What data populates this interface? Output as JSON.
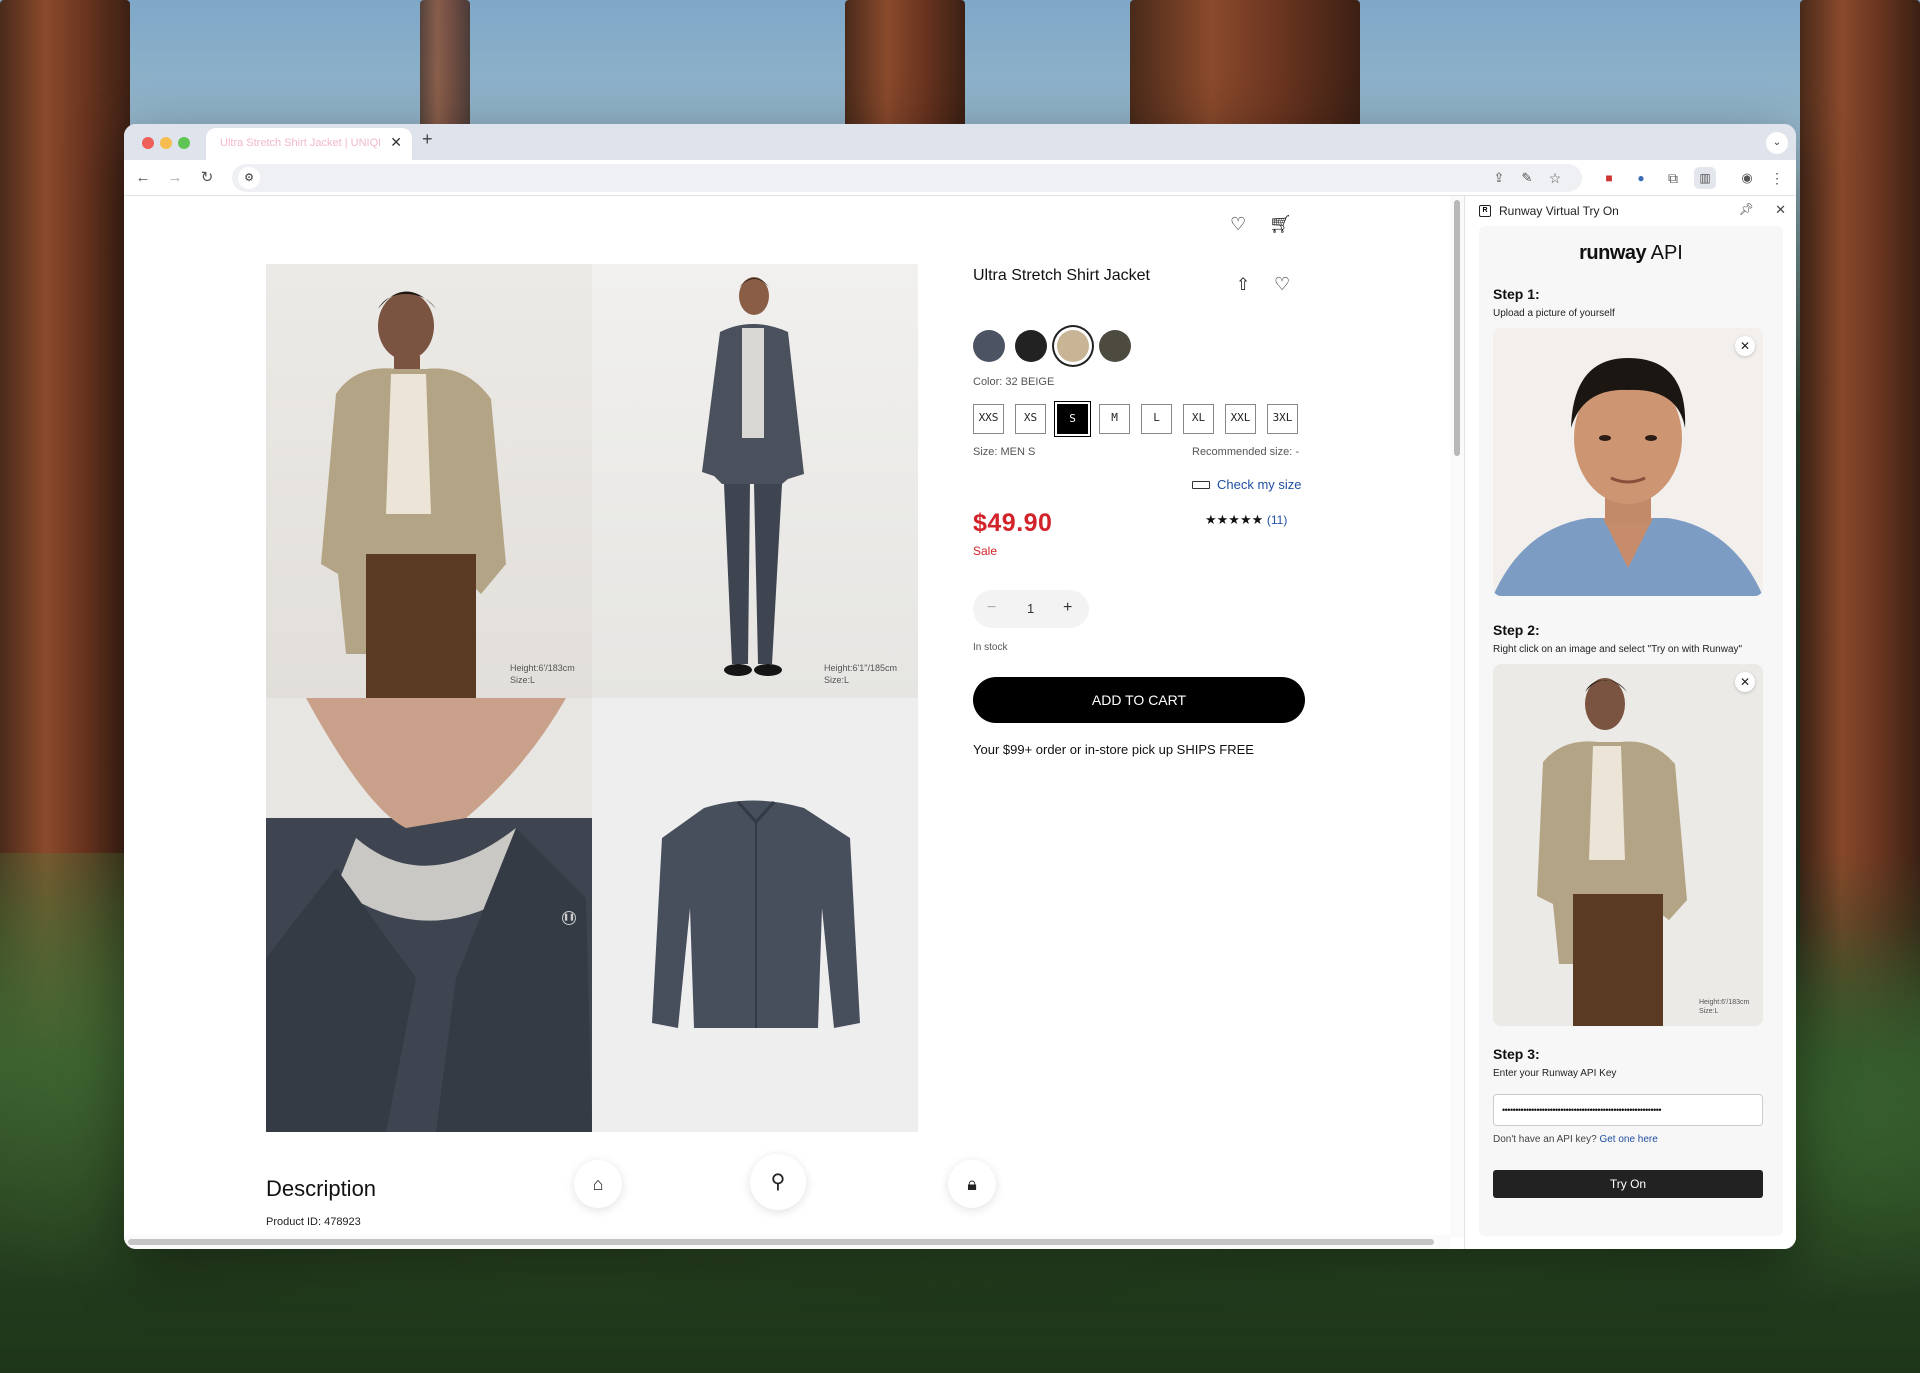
{
  "browser": {
    "tab_title": "Ultra Stretch Shirt Jacket | UNIQLO US",
    "new_tab_symbol": "+",
    "tab_close_symbol": "✕"
  },
  "page": {
    "product": {
      "name": "Ultra Stretch Shirt Jacket",
      "color_label": "Color: 32 BEIGE",
      "colors": [
        "#4c5362",
        "#222222",
        "#c7b595",
        "#4d4b40"
      ],
      "sizes": [
        "XXS",
        "XS",
        "S",
        "M",
        "L",
        "XL",
        "XXL",
        "3XL"
      ],
      "selected_size": "S",
      "size_label": "Size: MEN S",
      "recommended_size": "Recommended size: -",
      "check_size_label": "Check my size",
      "price": "$49.90",
      "sale_label": "Sale",
      "stars": "★★★★★",
      "rating_count": "(11)",
      "quantity": "1",
      "stock_status": "In stock",
      "add_to_cart_label": "ADD TO CART",
      "shipping_note": "Your $99+ order or in-store pick up SHIPS FREE",
      "description_title": "Description",
      "product_id": "Product ID: 478923"
    },
    "captions": {
      "photo1": [
        "Height:6'/183cm",
        "Size:L"
      ],
      "photo2": [
        "Height:6'1\"/185cm",
        "Size:L"
      ]
    }
  },
  "panel": {
    "title": "Runway Virtual Try On",
    "brand_bold": "runway",
    "brand_rest": " API",
    "step1_title": "Step 1:",
    "step1_sub": "Upload a picture of yourself",
    "step2_title": "Step 2:",
    "step2_sub": "Right click on an image and select \"Try on with Runway\"",
    "step2_caption": [
      "Height:6'/183cm",
      "Size:L"
    ],
    "step3_title": "Step 3:",
    "step3_sub": "Enter your Runway API Key",
    "api_key_mask": "••••••••••••••••••••••••••••••••••••••••••••••••••••••••••••",
    "api_note": "Don't have an API key?",
    "api_link": "Get one here",
    "try_on_label": "Try On"
  }
}
